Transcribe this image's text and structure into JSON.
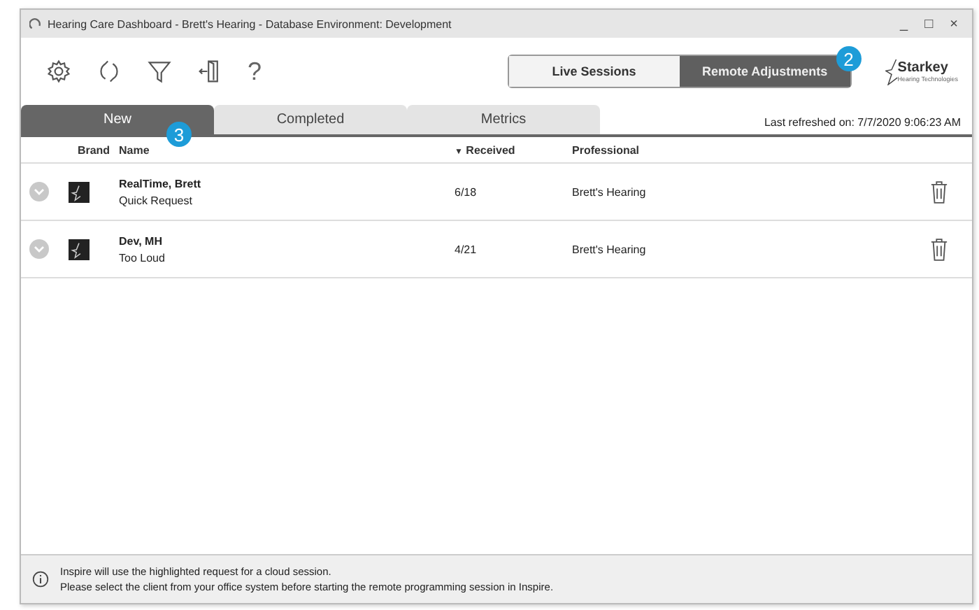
{
  "window": {
    "title": "Hearing Care Dashboard - Brett's Hearing - Database Environment: Development",
    "controls": [
      "_",
      "□",
      "×"
    ]
  },
  "toolbar": {
    "help": "?"
  },
  "mode_switch": {
    "callout": "2",
    "options": [
      {
        "label": "Live Sessions",
        "selected": false
      },
      {
        "label": "Remote Adjustments",
        "selected": true
      }
    ]
  },
  "logo": {
    "name": "Starkey",
    "tagline": "Hearing Technologies"
  },
  "tabs": {
    "callout": "3",
    "items": [
      {
        "label": "New",
        "selected": true
      },
      {
        "label": "Completed",
        "selected": false
      },
      {
        "label": "Metrics",
        "selected": false
      }
    ]
  },
  "last_refreshed": "Last refreshed on: 7/7/2020 9:06:23 AM",
  "table": {
    "columns": [
      "Brand",
      "Name",
      "Received",
      "Professional"
    ],
    "sort_indicator": "▼",
    "rows": [
      {
        "name": "RealTime, Brett",
        "request": "Quick Request",
        "received": "6/18",
        "professional": "Brett's Hearing"
      },
      {
        "name": "Dev, MH",
        "request": "Too Loud",
        "received": "4/21",
        "professional": "Brett's Hearing"
      }
    ]
  },
  "info": {
    "lines": [
      "Inspire will use the highlighted request for a cloud session.",
      "Please select the client from your office system before starting the remote programming session in Inspire."
    ]
  }
}
